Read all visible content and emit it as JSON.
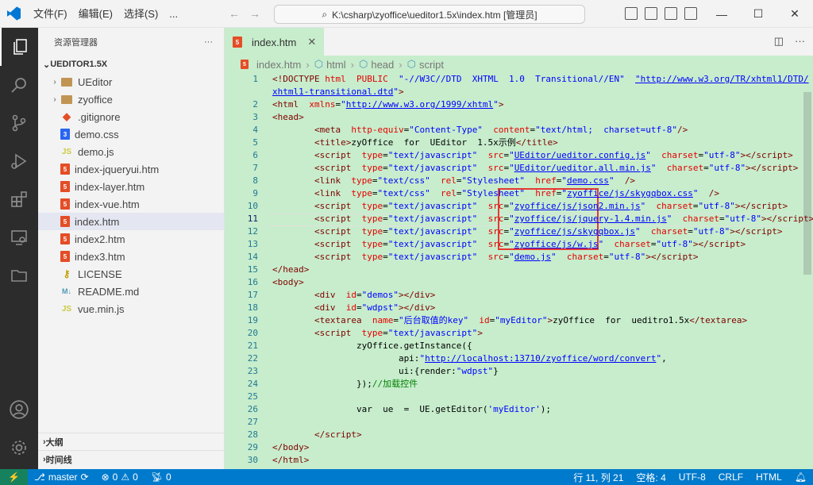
{
  "menu": [
    "文件(F)",
    "编辑(E)",
    "选择(S)",
    "..."
  ],
  "command_center": "K:\\csharp\\zyoffice\\ueditor1.5x\\index.htm [管理员]",
  "sidebar": {
    "title": "资源管理器",
    "more": "···",
    "root": "UEDITOR1.5X",
    "items": [
      {
        "label": "UEditor",
        "type": "folder"
      },
      {
        "label": "zyoffice",
        "type": "folder"
      },
      {
        "label": ".gitignore",
        "type": "git"
      },
      {
        "label": "demo.css",
        "type": "css"
      },
      {
        "label": "demo.js",
        "type": "js"
      },
      {
        "label": "index-jqueryui.htm",
        "type": "html"
      },
      {
        "label": "index-layer.htm",
        "type": "html"
      },
      {
        "label": "index-vue.htm",
        "type": "html"
      },
      {
        "label": "index.htm",
        "type": "html"
      },
      {
        "label": "index2.htm",
        "type": "html"
      },
      {
        "label": "index3.htm",
        "type": "html"
      },
      {
        "label": "LICENSE",
        "type": "license"
      },
      {
        "label": "README.md",
        "type": "md"
      },
      {
        "label": "vue.min.js",
        "type": "js"
      }
    ],
    "outline": "大纲",
    "timeline": "时间线"
  },
  "editor": {
    "tab": "index.htm",
    "breadcrumb": [
      "index.htm",
      "html",
      "head",
      "script"
    ]
  },
  "code_lines": [
    {
      "n": "1",
      "html": "<span class='tag'>&lt;!DOCTYPE</span> <span class='attr'>html</span>  <span class='attr'>PUBLIC</span>  <span class='val'>\"-//W3C//DTD  XHTML  1.0  Transitional//EN\"</span>  <span class='url'>\"http://www.w3.org/TR/xhtml1/DTD/</span>"
    },
    {
      "n": "",
      "html": "<span class='url'>xhtml1-transitional.dtd</span><span class='val'>\"</span><span class='tag'>&gt;</span>"
    },
    {
      "n": "2",
      "html": "<span class='tag'>&lt;html</span>  <span class='attr'>xmlns</span>=<span class='val'>\"</span><span class='url'>http://www.w3.org/1999/xhtml</span><span class='val'>\"</span><span class='tag'>&gt;</span>"
    },
    {
      "n": "3",
      "html": "<span class='tag'>&lt;head&gt;</span>"
    },
    {
      "n": "4",
      "html": "        <span class='tag'>&lt;meta</span>  <span class='attr'>http-equiv</span>=<span class='val'>\"Content-Type\"</span>  <span class='attr'>content</span>=<span class='val'>\"text/html;  charset=utf-8\"</span><span class='tag'>/&gt;</span>"
    },
    {
      "n": "5",
      "html": "        <span class='tag'>&lt;title&gt;</span>zyOffice  for  UEditor  1.5x示例<span class='tag'>&lt;/title&gt;</span>"
    },
    {
      "n": "6",
      "html": "        <span class='tag'>&lt;script</span>  <span class='attr'>type</span>=<span class='val'>\"text/javascript\"</span>  <span class='attr'>src</span>=<span class='val'>\"</span><span class='url'>UEditor/ueditor.config.js</span><span class='val'>\"</span>  <span class='attr'>charset</span>=<span class='val'>\"utf-8\"</span><span class='tag'>&gt;&lt;/script&gt;</span>"
    },
    {
      "n": "7",
      "html": "        <span class='tag'>&lt;script</span>  <span class='attr'>type</span>=<span class='val'>\"text/javascript\"</span>  <span class='attr'>src</span>=<span class='val'>\"</span><span class='url'>UEditor/ueditor.all.min.js</span><span class='val'>\"</span>  <span class='attr'>charset</span>=<span class='val'>\"utf-8\"</span><span class='tag'>&gt;&lt;/script&gt;</span>"
    },
    {
      "n": "8",
      "html": "        <span class='tag'>&lt;link</span>  <span class='attr'>type</span>=<span class='val'>\"text/css\"</span>  <span class='attr'>rel</span>=<span class='val'>\"Stylesheet\"</span>  <span class='attr'>href</span>=<span class='val'>\"</span><span class='url'>demo.css</span><span class='val'>\"</span>  <span class='tag'>/&gt;</span>"
    },
    {
      "n": "9",
      "html": "        <span class='tag'>&lt;link</span>  <span class='attr'>type</span>=<span class='val'>\"text/css\"</span>  <span class='attr'>rel</span>=<span class='val'>\"Stylesheet\"</span>  <span class='attr'>href</span>=<span class='val'>\"</span><span class='url'>zyoffice/js/skygqbox.css</span><span class='val'>\"</span>  <span class='tag'>/&gt;</span>"
    },
    {
      "n": "10",
      "html": "        <span class='tag'>&lt;script</span>  <span class='attr'>type</span>=<span class='val'>\"text/javascript\"</span>  <span class='attr'>src</span>=<span class='val'>\"</span><span class='url'>zyoffice/js/json2.min.js</span><span class='val'>\"</span>  <span class='attr'>charset</span>=<span class='val'>\"utf-8\"</span><span class='tag'>&gt;&lt;/script&gt;</span>"
    },
    {
      "n": "11",
      "html": "        <span class='tag'>&lt;script</span>  <span class='attr'>type</span>=<span class='val'>\"text/javascript\"</span>  <span class='attr'>src</span>=<span class='val'>\"</span><span class='url'>zyoffice/js/jquery-1.4.min.js</span><span class='val'>\"</span>  <span class='attr'>charset</span>=<span class='val'>\"utf-8\"</span><span class='tag'>&gt;&lt;/script&gt;</span>"
    },
    {
      "n": "12",
      "html": "        <span class='tag'>&lt;script</span>  <span class='attr'>type</span>=<span class='val'>\"text/javascript\"</span>  <span class='attr'>src</span>=<span class='val'>\"</span><span class='url'>zyoffice/js/skygqbox.js</span><span class='val'>\"</span>  <span class='attr'>charset</span>=<span class='val'>\"utf-8\"</span><span class='tag'>&gt;&lt;/script&gt;</span>"
    },
    {
      "n": "13",
      "html": "        <span class='tag'>&lt;script</span>  <span class='attr'>type</span>=<span class='val'>\"text/javascript\"</span>  <span class='attr'>src</span>=<span class='val'>\"</span><span class='url'>zyoffice/js/w.js</span><span class='val'>\"</span>  <span class='attr'>charset</span>=<span class='val'>\"utf-8\"</span><span class='tag'>&gt;&lt;/script&gt;</span>"
    },
    {
      "n": "14",
      "html": "        <span class='tag'>&lt;script</span>  <span class='attr'>type</span>=<span class='val'>\"text/javascript\"</span>  <span class='attr'>src</span>=<span class='val'>\"</span><span class='url'>demo.js</span><span class='val'>\"</span>  <span class='attr'>charset</span>=<span class='val'>\"utf-8\"</span><span class='tag'>&gt;&lt;/script&gt;</span>"
    },
    {
      "n": "15",
      "html": "<span class='tag'>&lt;/head&gt;</span>"
    },
    {
      "n": "16",
      "html": "<span class='tag'>&lt;body&gt;</span>"
    },
    {
      "n": "17",
      "html": "        <span class='tag'>&lt;div</span>  <span class='attr'>id</span>=<span class='val'>\"demos\"</span><span class='tag'>&gt;&lt;/div&gt;</span>"
    },
    {
      "n": "18",
      "html": "        <span class='tag'>&lt;div</span>  <span class='attr'>id</span>=<span class='val'>\"wdpst\"</span><span class='tag'>&gt;&lt;/div&gt;</span>"
    },
    {
      "n": "19",
      "html": "        <span class='tag'>&lt;textarea</span>  <span class='attr'>name</span>=<span class='val'>\"后台取值的key\"</span>  <span class='attr'>id</span>=<span class='val'>\"myEditor\"</span><span class='tag'>&gt;</span>zyOffice  for  ueditro1.5x<span class='tag'>&lt;/textarea&gt;</span>"
    },
    {
      "n": "20",
      "html": "        <span class='tag'>&lt;script</span>  <span class='attr'>type</span>=<span class='val'>\"text/javascript\"</span><span class='tag'>&gt;</span>"
    },
    {
      "n": "21",
      "html": "                zyOffice.getInstance({"
    },
    {
      "n": "22",
      "html": "                        api:<span class='val'>\"</span><span class='url'>http://localhost:13710/zyoffice/word/convert</span><span class='val'>\"</span>,"
    },
    {
      "n": "23",
      "html": "                        ui:{render:<span class='val'>\"wdpst\"</span>}"
    },
    {
      "n": "24",
      "html": "                });<span class='cm'>//加载控件</span>"
    },
    {
      "n": "25",
      "html": ""
    },
    {
      "n": "26",
      "html": "                var  ue  =  UE.getEditor(<span class='val'>'myEditor'</span>);"
    },
    {
      "n": "27",
      "html": ""
    },
    {
      "n": "28",
      "html": "        <span class='tag'>&lt;/script&gt;</span>"
    },
    {
      "n": "29",
      "html": "<span class='tag'>&lt;/body&gt;</span>"
    },
    {
      "n": "30",
      "html": "<span class='tag'>&lt;/html&gt;</span>"
    }
  ],
  "status": {
    "branch": "master",
    "errors": "0",
    "warnings": "0",
    "ports": "0",
    "position": "行 11, 列 21",
    "spaces": "空格: 4",
    "encoding": "UTF-8",
    "eol": "CRLF",
    "language": "HTML"
  },
  "colors": {
    "editor_bg": "#c7edcc",
    "status_bg": "#007acc",
    "activity_bg": "#2c2c2c",
    "highlight_box": "#e53935"
  }
}
